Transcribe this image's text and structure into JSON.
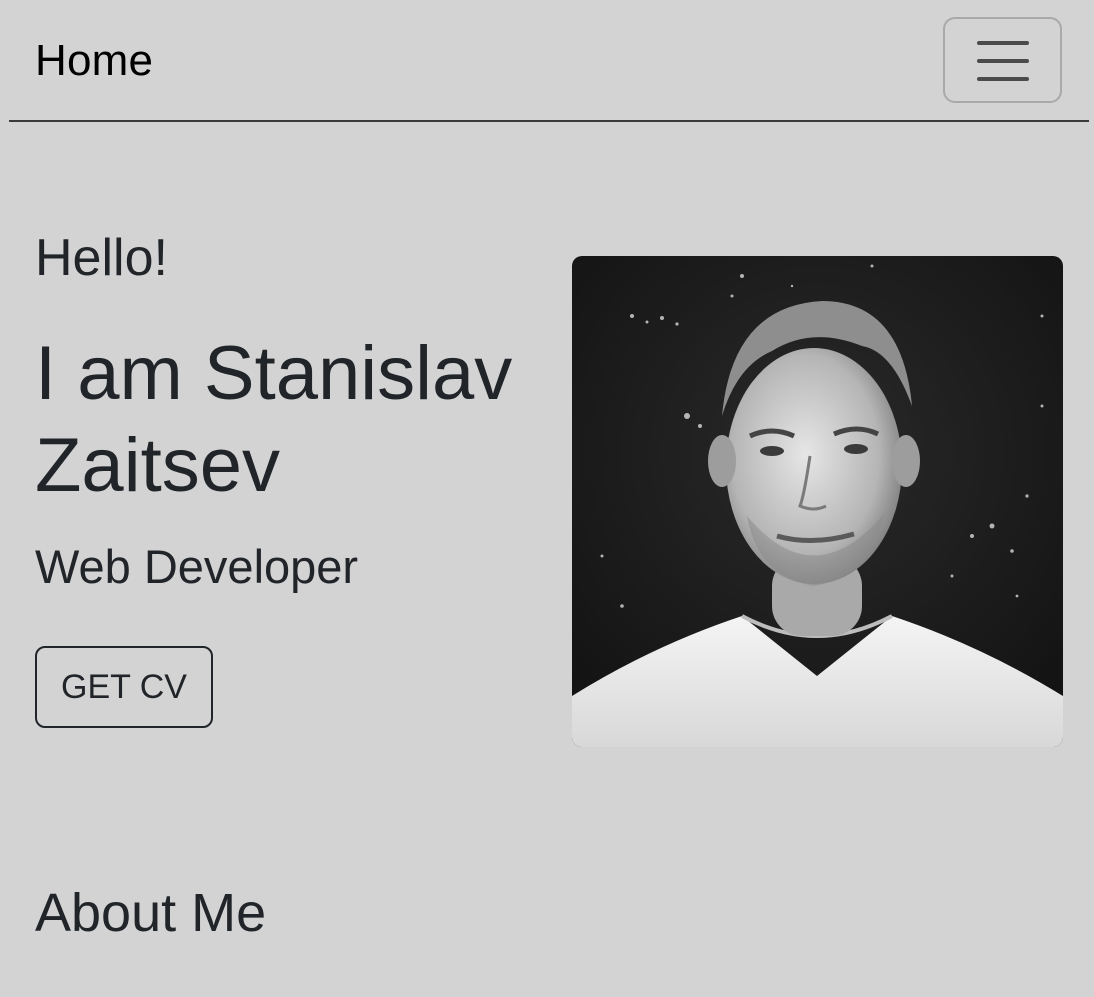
{
  "nav": {
    "brand": "Home",
    "toggle_icon": "hamburger-icon"
  },
  "hero": {
    "greeting": "Hello!",
    "name": "I am Stanislav Zaitsev",
    "role": "Web Developer",
    "cv_button": "GET CV",
    "photo": "portrait-photo"
  },
  "about": {
    "heading": "About Me"
  },
  "colors": {
    "background": "#d3d3d3",
    "text": "#212529"
  }
}
